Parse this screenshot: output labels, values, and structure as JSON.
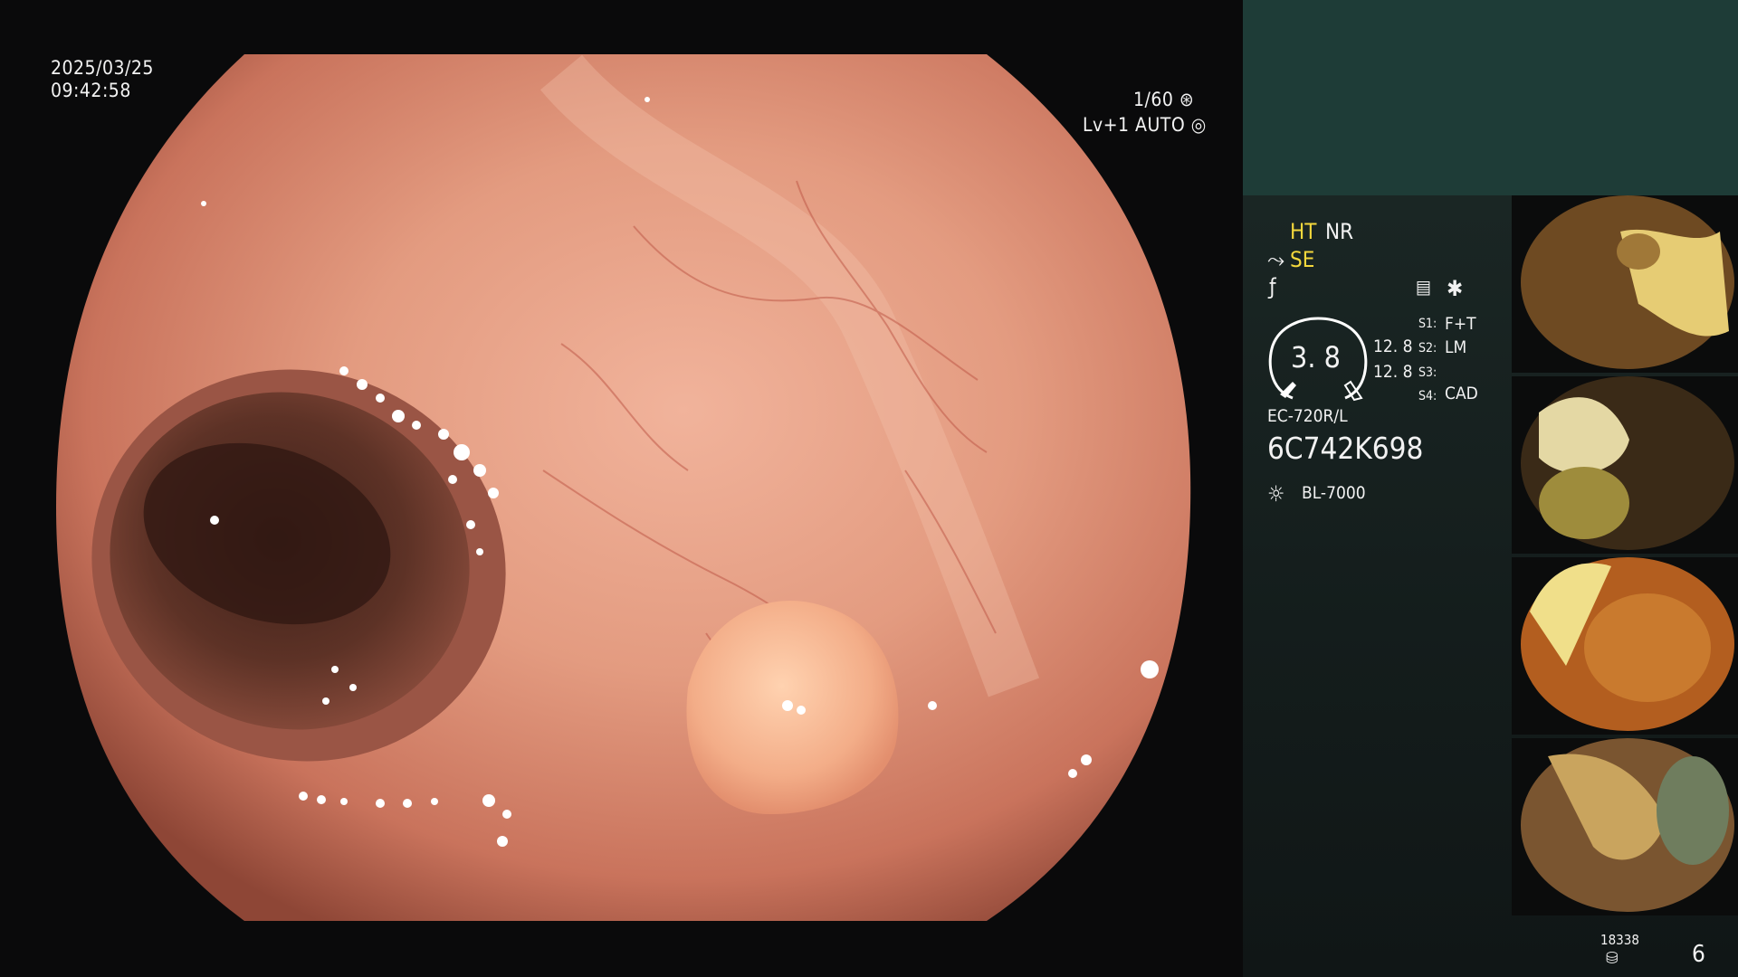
{
  "overlay": {
    "date": "2025/03/25",
    "time": "09:42:58",
    "shutter": "1/60",
    "level": "Lv+1",
    "iris_mode": "AUTO"
  },
  "panel": {
    "enh_ht": "HT",
    "enh_nr": "NR",
    "enh_se": "SE",
    "zoom_value": "3. 8",
    "zoom_a": "12. 8",
    "zoom_b": "12. 8",
    "s1_key": "S1:",
    "s1_val": "F+T",
    "s2_key": "S2:",
    "s2_val": "LM",
    "s3_key": "S3:",
    "s3_val": "",
    "s4_key": "S4:",
    "s4_val": "CAD",
    "scope_model": "EC-720R/L",
    "scope_serial": "6C742K698",
    "light_source": "BL-7000",
    "capacity": "18338",
    "capture_count": "6"
  },
  "thumbnails": [
    {
      "label": "capture-1",
      "tone": "#c9a35a"
    },
    {
      "label": "capture-2",
      "tone": "#b8a760"
    },
    {
      "label": "capture-3",
      "tone": "#c97a2e"
    },
    {
      "label": "capture-4",
      "tone": "#b88a52"
    }
  ],
  "colors": {
    "mucosa": "#d9876e",
    "panel_top": "#1e3c37",
    "highlight": "#f4d83c"
  }
}
